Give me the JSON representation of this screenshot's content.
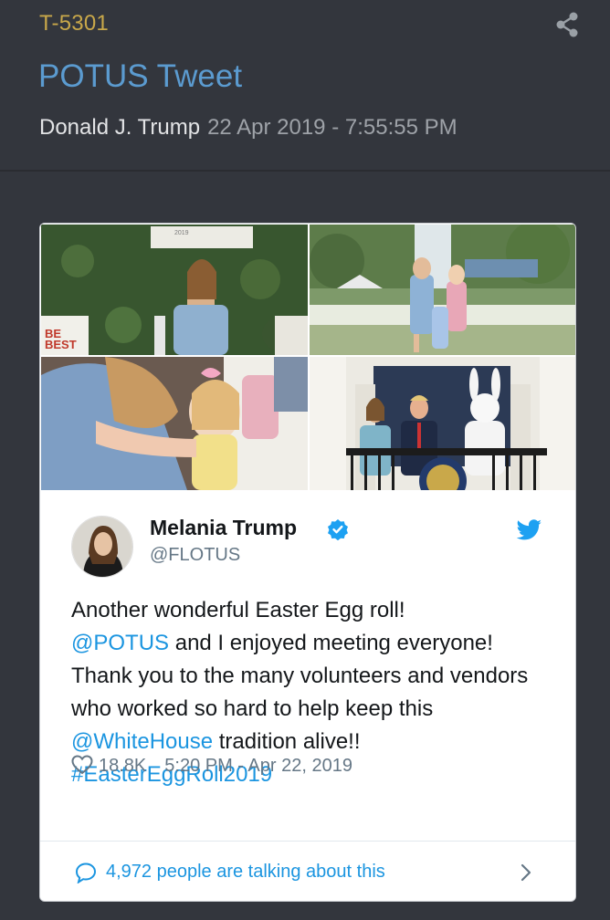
{
  "post": {
    "id": "T-5301",
    "title": "POTUS Tweet",
    "author": "Donald J. Trump",
    "date": "22 Apr 2019 - 7:55:55 PM"
  },
  "tweet": {
    "name": "Melania Trump",
    "handle": "@FLOTUS",
    "text_parts": {
      "p1": "Another wonderful Easter Egg roll!",
      "mention_potus": "@POTUS",
      "p2": " and I enjoyed meeting everyone! Thank you to the many volunteers and vendors who worked so hard to help keep this ",
      "mention_wh": "@WhiteHouse",
      "p3": " tradition alive!!",
      "hashtag": "#EasterEggRoll2019"
    },
    "likes": "18.8K",
    "timestamp": "5:20 PM - Apr 22, 2019",
    "talking": "4,972 people are talking about this"
  },
  "photos": {
    "p1_year": "2019",
    "p1_sign": "BE BEST"
  },
  "icons": {
    "share": "share-icon",
    "info": "info-icon",
    "verified": "verified-badge-icon",
    "twitter": "twitter-bird-icon",
    "heart": "heart-icon",
    "comment": "comment-bubble-icon",
    "chevron": "chevron-right-icon"
  },
  "colors": {
    "background": "#33363d",
    "post_id": "#c9a84a",
    "title": "#5b9bd0",
    "twitter_blue": "#1b95e0"
  }
}
